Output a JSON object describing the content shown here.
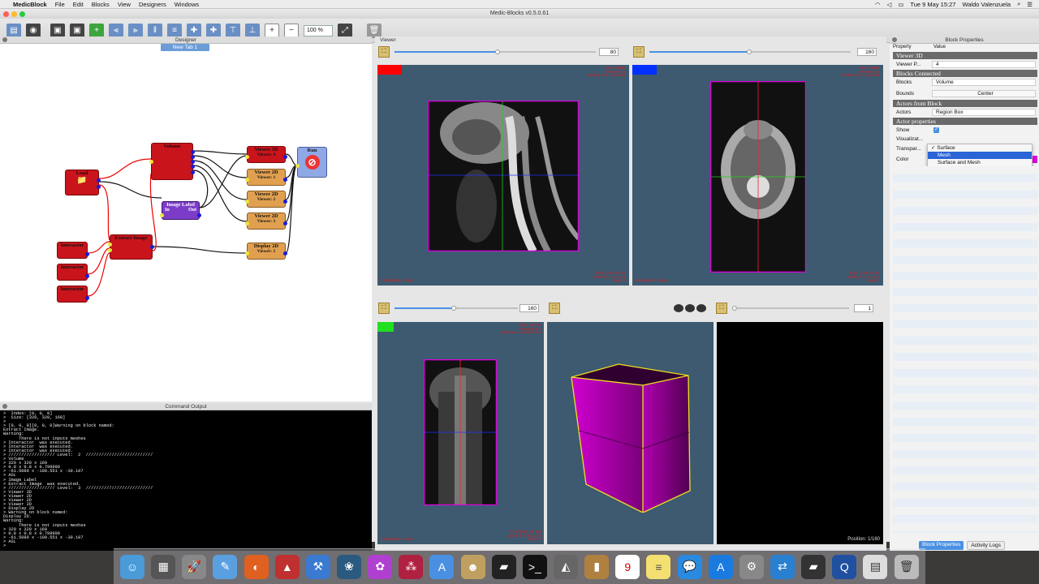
{
  "menubar": {
    "app": "MedicBlock",
    "items": [
      "File",
      "Edit",
      "Blocks",
      "View",
      "Designers",
      "Windows"
    ],
    "clock": "Tue 9 May  15:27",
    "user": "Waldo Valenzuela"
  },
  "window": {
    "title": "Medic-Blocks v0.5.0.61"
  },
  "toolbar": {
    "zoom_value": "100 %"
  },
  "designer": {
    "title": "Designer",
    "tab": "New Tab 1",
    "blocks": {
      "load": "Load",
      "load_out": "Out",
      "load_path": "Path",
      "volume": "Volume",
      "volume_ports": [
        "Image",
        "Blocks",
        "Show"
      ],
      "extract": "Extract Image",
      "extract_ports": [
        "Interactor",
        "Interactor"
      ],
      "interactor1": "Interactor",
      "interactor2": "Interactor",
      "interactor3": "Interactor",
      "interactor_port": "Viewer",
      "image_label": "Image Label",
      "image_label_in": "In",
      "image_label_out": "Out",
      "viewer3d": "Viewer 3D",
      "viewer3d_port": "Viewer: 4",
      "viewer2d_1": "Viewer 2D",
      "viewer2d_1_port": "Viewer: 1",
      "viewer2d_2": "Viewer 2D",
      "viewer2d_2_port": "Viewer: 2",
      "viewer2d_3": "Viewer 2D",
      "viewer2d_3_port": "Viewer: 3",
      "display2d": "Display 2D",
      "display2d_port": "Viewer: 5",
      "out": "Out",
      "run": "Run",
      "run_in": "In"
    }
  },
  "command_output": {
    "title": "Command Output",
    "lines": [
      ">  Index: [0, 0, 0]",
      ">  Size: [320, 320, 160]",
      ">",
      "> [0, 0, 0][0, 0, 0]Warning on block named:",
      "Extract Image.",
      "Warning:",
      "      There is not inputs meshes",
      "> Interactor  was executed.",
      "> Interactor  was executed.",
      "> Interactor  was executed.",
      "> ////////////////// Level:  2  //////////////////////////",
      "> Volume",
      "> 320 x 320 x 160",
      "> 0.8 x 0.8 x 0.799999",
      "> -61.5089 x -100.551 x -39.107",
      "> ASL",
      "> Image Label",
      "> Extract Image  was executed.",
      "> ////////////////// Level:  3  //////////////////////////",
      "> Viewer 3D",
      "> Viewer 2D",
      "> Viewer 2D",
      "> Viewer 2D",
      "> Display 2D",
      "> Warning on block named:",
      "Display 2D.",
      "Warning:",
      "      There is not inputs meshes",
      "> 320 x 320 x 160",
      "> 0.8 x 0.8 x 0.799999",
      "> -61.5089 x -100.551 x -39.107",
      "> ASL",
      ">"
    ]
  },
  "viewer": {
    "title": "Viewer",
    "slider1_value": "80",
    "slider2_value": "160",
    "slider3_value": "160",
    "slider4_value": "1",
    "position_label": "Position: 1/160",
    "overlay_top": [
      "Slice: 80/160",
      "Intensity: 0.0",
      "Window: 512 Level: 256"
    ],
    "overlay_bottom": [
      "Pixel: [160, 80, 80]",
      "World: [0.0, 0.0, 0.0]",
      "Value: 0"
    ],
    "overlay_left": "Interpolation: Linear"
  },
  "properties": {
    "title": "Block Properties",
    "col_property": "Property",
    "col_value": "Value",
    "sections": {
      "viewer3d": "Viewer 3D",
      "blocks_connected": "Blocks Connected",
      "actors_from_block": "Actors from Block",
      "actor_properties": "Actor properties"
    },
    "rows": {
      "viewer_p_label": "Viewer P...",
      "viewer_p_value": "4",
      "blocks_label": "Blocks",
      "blocks_value": "Volume",
      "bounds_label": "Bounds",
      "bounds_value": "Center",
      "actors_label": "Actors",
      "actors_value": "Region Box",
      "show_label": "Show",
      "visualization_label": "Visualizat...",
      "transparency_label": "Transpar...",
      "color_label": "Color"
    },
    "dropdown": {
      "options": [
        "Surface",
        "Mesh",
        "Surface and Mesh"
      ],
      "selected": "Surface",
      "highlighted": "Mesh"
    },
    "tabs": {
      "block_properties": "Block Properties",
      "activity_logs": "Activity Logs"
    }
  },
  "colors": {
    "accent": "#4a90e2",
    "block_red": "#c9141c",
    "block_orange": "#e0a050",
    "block_purple": "#7d3cc8",
    "viewport_bg": "#3d5a70",
    "magenta": "#e000e0"
  }
}
